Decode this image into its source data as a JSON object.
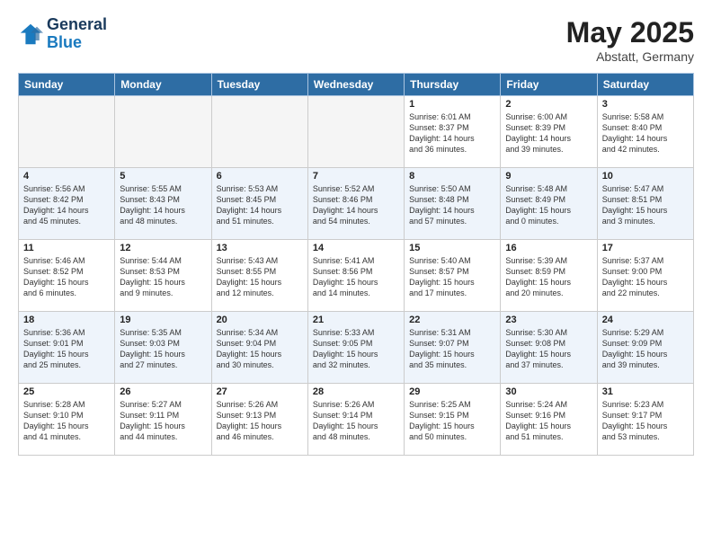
{
  "header": {
    "logo_line1": "General",
    "logo_line2": "Blue",
    "month_year": "May 2025",
    "location": "Abstatt, Germany"
  },
  "days_of_week": [
    "Sunday",
    "Monday",
    "Tuesday",
    "Wednesday",
    "Thursday",
    "Friday",
    "Saturday"
  ],
  "weeks": [
    [
      {
        "day": "",
        "info": ""
      },
      {
        "day": "",
        "info": ""
      },
      {
        "day": "",
        "info": ""
      },
      {
        "day": "",
        "info": ""
      },
      {
        "day": "1",
        "info": "Sunrise: 6:01 AM\nSunset: 8:37 PM\nDaylight: 14 hours\nand 36 minutes."
      },
      {
        "day": "2",
        "info": "Sunrise: 6:00 AM\nSunset: 8:39 PM\nDaylight: 14 hours\nand 39 minutes."
      },
      {
        "day": "3",
        "info": "Sunrise: 5:58 AM\nSunset: 8:40 PM\nDaylight: 14 hours\nand 42 minutes."
      }
    ],
    [
      {
        "day": "4",
        "info": "Sunrise: 5:56 AM\nSunset: 8:42 PM\nDaylight: 14 hours\nand 45 minutes."
      },
      {
        "day": "5",
        "info": "Sunrise: 5:55 AM\nSunset: 8:43 PM\nDaylight: 14 hours\nand 48 minutes."
      },
      {
        "day": "6",
        "info": "Sunrise: 5:53 AM\nSunset: 8:45 PM\nDaylight: 14 hours\nand 51 minutes."
      },
      {
        "day": "7",
        "info": "Sunrise: 5:52 AM\nSunset: 8:46 PM\nDaylight: 14 hours\nand 54 minutes."
      },
      {
        "day": "8",
        "info": "Sunrise: 5:50 AM\nSunset: 8:48 PM\nDaylight: 14 hours\nand 57 minutes."
      },
      {
        "day": "9",
        "info": "Sunrise: 5:48 AM\nSunset: 8:49 PM\nDaylight: 15 hours\nand 0 minutes."
      },
      {
        "day": "10",
        "info": "Sunrise: 5:47 AM\nSunset: 8:51 PM\nDaylight: 15 hours\nand 3 minutes."
      }
    ],
    [
      {
        "day": "11",
        "info": "Sunrise: 5:46 AM\nSunset: 8:52 PM\nDaylight: 15 hours\nand 6 minutes."
      },
      {
        "day": "12",
        "info": "Sunrise: 5:44 AM\nSunset: 8:53 PM\nDaylight: 15 hours\nand 9 minutes."
      },
      {
        "day": "13",
        "info": "Sunrise: 5:43 AM\nSunset: 8:55 PM\nDaylight: 15 hours\nand 12 minutes."
      },
      {
        "day": "14",
        "info": "Sunrise: 5:41 AM\nSunset: 8:56 PM\nDaylight: 15 hours\nand 14 minutes."
      },
      {
        "day": "15",
        "info": "Sunrise: 5:40 AM\nSunset: 8:57 PM\nDaylight: 15 hours\nand 17 minutes."
      },
      {
        "day": "16",
        "info": "Sunrise: 5:39 AM\nSunset: 8:59 PM\nDaylight: 15 hours\nand 20 minutes."
      },
      {
        "day": "17",
        "info": "Sunrise: 5:37 AM\nSunset: 9:00 PM\nDaylight: 15 hours\nand 22 minutes."
      }
    ],
    [
      {
        "day": "18",
        "info": "Sunrise: 5:36 AM\nSunset: 9:01 PM\nDaylight: 15 hours\nand 25 minutes."
      },
      {
        "day": "19",
        "info": "Sunrise: 5:35 AM\nSunset: 9:03 PM\nDaylight: 15 hours\nand 27 minutes."
      },
      {
        "day": "20",
        "info": "Sunrise: 5:34 AM\nSunset: 9:04 PM\nDaylight: 15 hours\nand 30 minutes."
      },
      {
        "day": "21",
        "info": "Sunrise: 5:33 AM\nSunset: 9:05 PM\nDaylight: 15 hours\nand 32 minutes."
      },
      {
        "day": "22",
        "info": "Sunrise: 5:31 AM\nSunset: 9:07 PM\nDaylight: 15 hours\nand 35 minutes."
      },
      {
        "day": "23",
        "info": "Sunrise: 5:30 AM\nSunset: 9:08 PM\nDaylight: 15 hours\nand 37 minutes."
      },
      {
        "day": "24",
        "info": "Sunrise: 5:29 AM\nSunset: 9:09 PM\nDaylight: 15 hours\nand 39 minutes."
      }
    ],
    [
      {
        "day": "25",
        "info": "Sunrise: 5:28 AM\nSunset: 9:10 PM\nDaylight: 15 hours\nand 41 minutes."
      },
      {
        "day": "26",
        "info": "Sunrise: 5:27 AM\nSunset: 9:11 PM\nDaylight: 15 hours\nand 44 minutes."
      },
      {
        "day": "27",
        "info": "Sunrise: 5:26 AM\nSunset: 9:13 PM\nDaylight: 15 hours\nand 46 minutes."
      },
      {
        "day": "28",
        "info": "Sunrise: 5:26 AM\nSunset: 9:14 PM\nDaylight: 15 hours\nand 48 minutes."
      },
      {
        "day": "29",
        "info": "Sunrise: 5:25 AM\nSunset: 9:15 PM\nDaylight: 15 hours\nand 50 minutes."
      },
      {
        "day": "30",
        "info": "Sunrise: 5:24 AM\nSunset: 9:16 PM\nDaylight: 15 hours\nand 51 minutes."
      },
      {
        "day": "31",
        "info": "Sunrise: 5:23 AM\nSunset: 9:17 PM\nDaylight: 15 hours\nand 53 minutes."
      }
    ]
  ]
}
